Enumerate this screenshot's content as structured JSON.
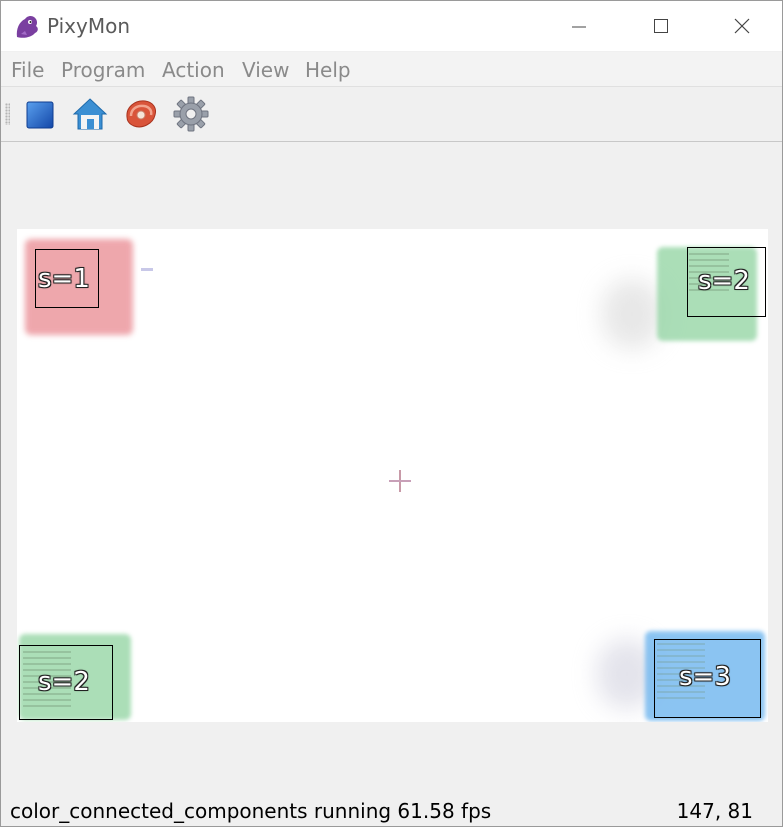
{
  "window": {
    "title": "PixyMon"
  },
  "menu": {
    "items": [
      "File",
      "Program",
      "Action",
      "View",
      "Help"
    ]
  },
  "toolbar": {
    "buttons": [
      {
        "icon": "stop-square-icon",
        "color": "#1f66c8"
      },
      {
        "icon": "home-icon",
        "color": "#3b8fd3"
      },
      {
        "icon": "raw-meat-icon",
        "color": "#d9543a"
      },
      {
        "icon": "gear-icon",
        "color": "#8e8e9a"
      }
    ]
  },
  "video": {
    "blocks": [
      {
        "label": "s=1",
        "color": "#e8828a"
      },
      {
        "label": "s=2",
        "color": "#8fd3a0"
      },
      {
        "label": "s=2",
        "color": "#8fd3a0"
      },
      {
        "label": "s=3",
        "color": "#6fb6ef"
      }
    ]
  },
  "status": {
    "text": "color_connected_components running 61.58 fps",
    "coords": "147, 81"
  }
}
